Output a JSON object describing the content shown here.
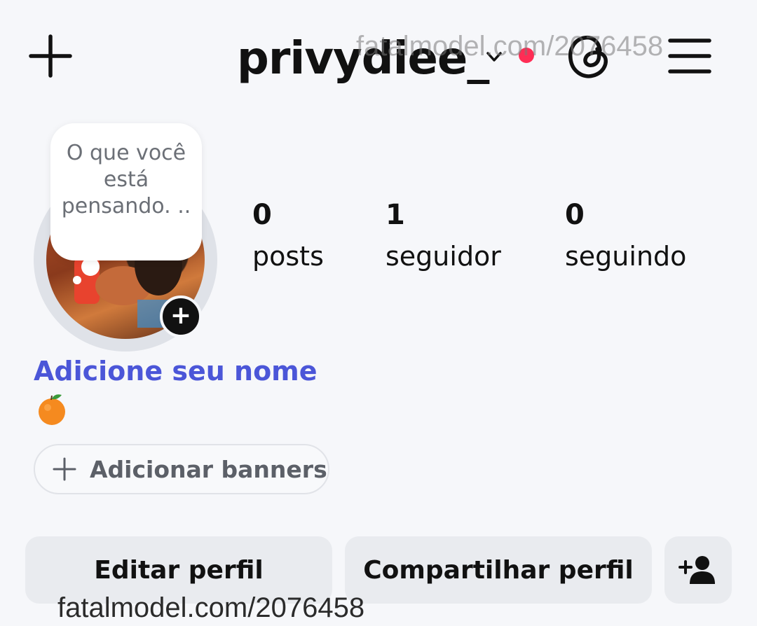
{
  "header": {
    "username": "privydiee_",
    "notification_color": "#ff2d55"
  },
  "note": {
    "text": "O que você está pensando. .."
  },
  "stats": [
    {
      "value": "0",
      "label": "posts"
    },
    {
      "value": "1",
      "label": "seguidor"
    },
    {
      "value": "0",
      "label": "seguindo"
    }
  ],
  "profile": {
    "add_name_label": "Adicione seu nome",
    "bio_emoji": "tangerine-icon",
    "banner_label": "Adicionar banners"
  },
  "actions": {
    "edit_label": "Editar perfil",
    "share_label": "Compartilhar perfil"
  },
  "watermark": {
    "text": "fatalmodel.com/2076458"
  },
  "colors": {
    "link": "#4b56d8",
    "background": "#f6f7fa",
    "button_bg": "#e9ebef"
  }
}
